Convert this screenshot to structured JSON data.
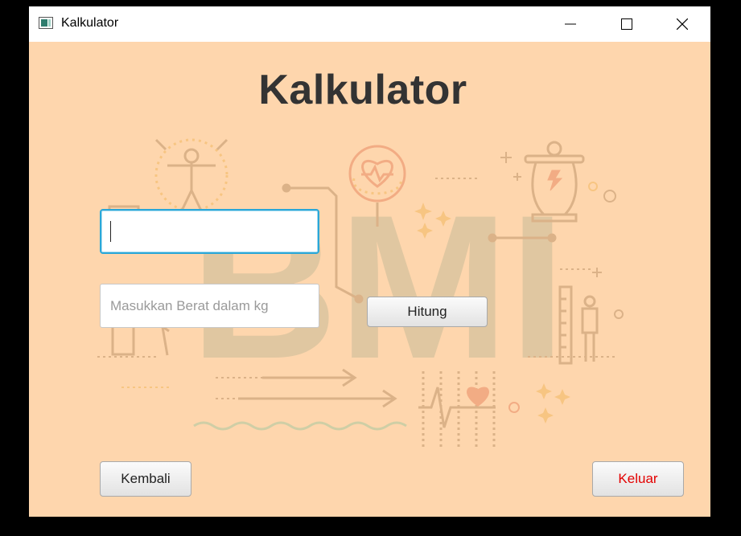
{
  "window": {
    "title": "Kalkulator",
    "controls": [
      "minimize-icon",
      "maximize-icon",
      "close-icon"
    ]
  },
  "heading": "Kalkulator",
  "form": {
    "first_input": {
      "value": "",
      "placeholder": ""
    },
    "weight_input": {
      "value": "",
      "placeholder": "Masukkan Berat dalam kg"
    },
    "calculate_label": "Hitung"
  },
  "footer": {
    "back_label": "Kembali",
    "exit_label": "Keluar"
  },
  "background": {
    "watermark_text": "BMI",
    "icons": [
      "person-icon",
      "heart-icon",
      "scale-person-icon",
      "ruler-icon",
      "heartbeat-icon"
    ]
  },
  "colors": {
    "window_bg": "#fed6ad",
    "heading": "#333333",
    "focus_border": "#2aa7d8",
    "exit_text": "#e30000"
  }
}
